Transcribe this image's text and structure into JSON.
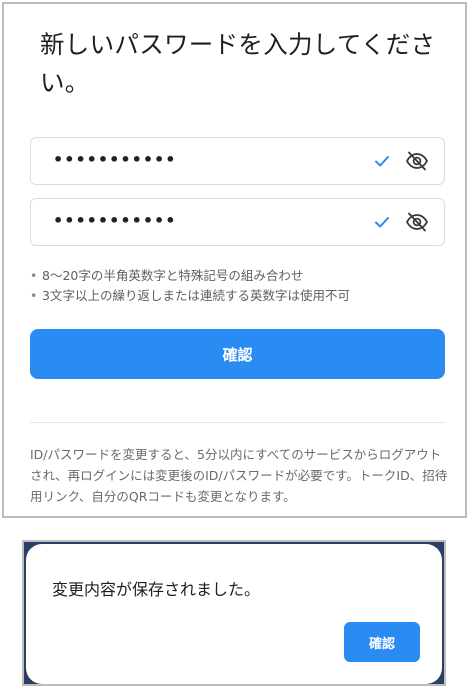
{
  "form": {
    "title": "新しいパスワードを入力してください。",
    "password_field": {
      "masked_value": "•••••••••••",
      "check_icon": "checkmark-icon",
      "visibility_icon": "eye-off-icon"
    },
    "confirm_password_field": {
      "masked_value": "•••••••••••",
      "check_icon": "checkmark-icon",
      "visibility_icon": "eye-off-icon"
    },
    "rules": [
      "8～20字の半角英数字と特殊記号の組み合わせ",
      "3文字以上の繰り返しまたは連続する英数字は使用不可"
    ],
    "confirm_label": "確認",
    "notice": "ID/パスワードを変更すると、5分以内にすべてのサービスからログアウトされ、再ログインには変更後のID/パスワードが必要です。トークID、招待用リンク、自分のQRコードも変更となります。"
  },
  "dialog": {
    "message": "変更内容が保存されました。",
    "ok_label": "確認"
  },
  "colors": {
    "accent": "#2a8cf2",
    "check": "#2a8cf2",
    "icon": "#3a3a3a",
    "backdrop": "#2c3e63"
  }
}
